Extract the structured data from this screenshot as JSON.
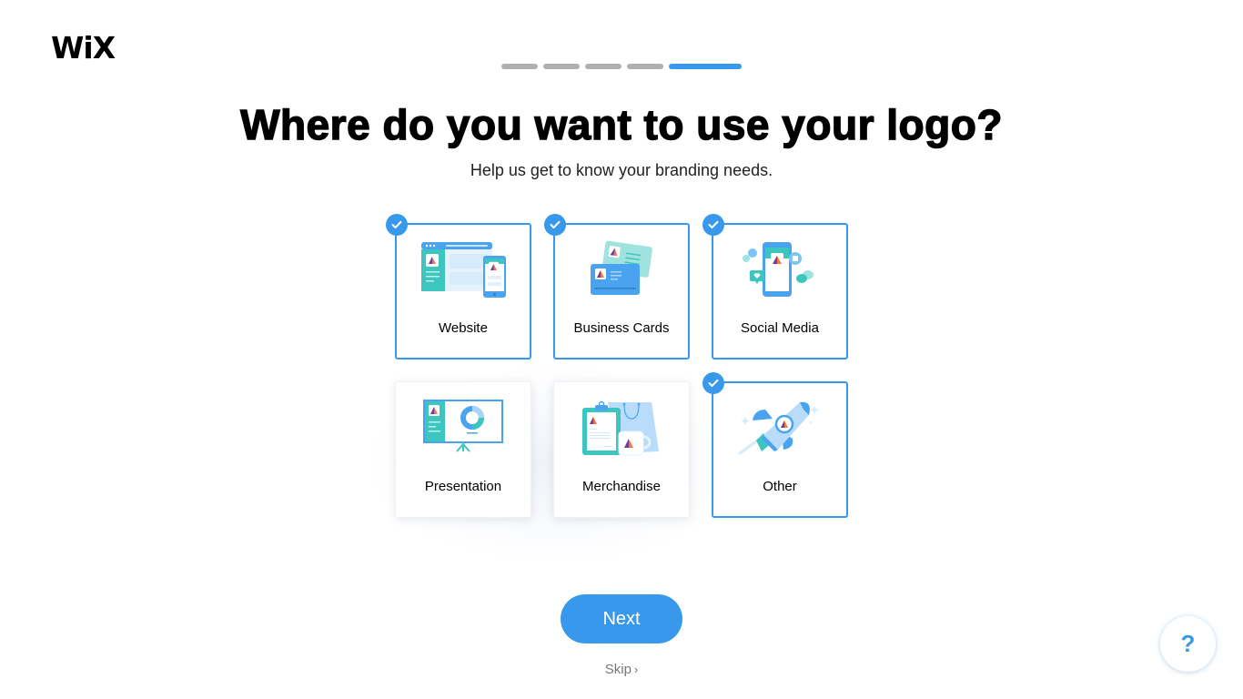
{
  "brand": {
    "logo_text": "WiX"
  },
  "progress": {
    "total_steps": 5,
    "current_step": 5
  },
  "header": {
    "title": "Where do you want to use your logo?",
    "subtitle": "Help us get to know your branding needs."
  },
  "options": [
    {
      "id": "website",
      "label": "Website",
      "icon": "website-icon",
      "selected": true
    },
    {
      "id": "business-cards",
      "label": "Business Cards",
      "icon": "business-cards-icon",
      "selected": true
    },
    {
      "id": "social-media",
      "label": "Social Media",
      "icon": "social-media-icon",
      "selected": true
    },
    {
      "id": "presentation",
      "label": "Presentation",
      "icon": "presentation-icon",
      "selected": false
    },
    {
      "id": "merchandise",
      "label": "Merchandise",
      "icon": "merchandise-icon",
      "selected": false
    },
    {
      "id": "other",
      "label": "Other",
      "icon": "rocket-icon",
      "selected": true
    }
  ],
  "actions": {
    "next_label": "Next",
    "skip_label": "Skip",
    "skip_chevron": "›",
    "help_label": "?"
  },
  "colors": {
    "accent": "#3899ec",
    "teal": "#3dc6c0",
    "progress_inactive": "#b0b0b0"
  }
}
